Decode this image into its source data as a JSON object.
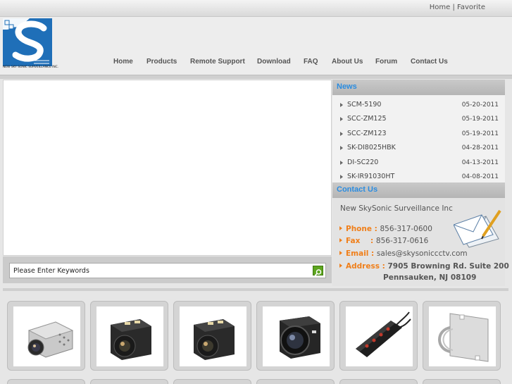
{
  "top_links": {
    "home": "Home",
    "separator": "|",
    "favorite": "Favorite"
  },
  "logo": {
    "company_caption": "NEW SKY SONIC SURVEILLANCE INC."
  },
  "nav": [
    "Home",
    "Products",
    "Remote Support",
    "Download",
    "FAQ",
    "About Us",
    "Forum",
    "Contact Us"
  ],
  "search": {
    "placeholder": "Please Enter Keywords"
  },
  "news": {
    "title": "News",
    "items": [
      {
        "title": "SCM-5190",
        "date": "05-20-2011"
      },
      {
        "title": "SCC-ZM125",
        "date": "05-19-2011"
      },
      {
        "title": "SCC-ZM123",
        "date": "05-19-2011"
      },
      {
        "title": "SK-DI8025HBK",
        "date": "04-28-2011"
      },
      {
        "title": "DI-SC220",
        "date": "04-13-2011"
      },
      {
        "title": "SK-IR91030HT",
        "date": "04-08-2011"
      }
    ]
  },
  "contact": {
    "title": "Contact Us",
    "company": "New SkySonic Surveillance Inc",
    "phone_label": "Phone :",
    "phone": "856-317-0600",
    "fax_label": "Fax    :",
    "fax": "856-317-0616",
    "email_label": "Email :",
    "email": "sales@skysoniccctv.com",
    "address_label": "Address :",
    "address_line1": "7905 Browning Rd. Suite 200",
    "address_line2": "Pennsauken, NJ 08109"
  },
  "products": [
    {
      "icon": "zoom-camera-module-icon"
    },
    {
      "icon": "block-camera-icon"
    },
    {
      "icon": "block-camera-icon"
    },
    {
      "icon": "box-camera-icon"
    },
    {
      "icon": "power-distribution-box-icon"
    },
    {
      "icon": "pole-mount-bracket-icon"
    }
  ],
  "colors": {
    "accent_blue": "#2a8ce0",
    "accent_orange": "#f07f1a",
    "search_green": "#5da51f"
  }
}
